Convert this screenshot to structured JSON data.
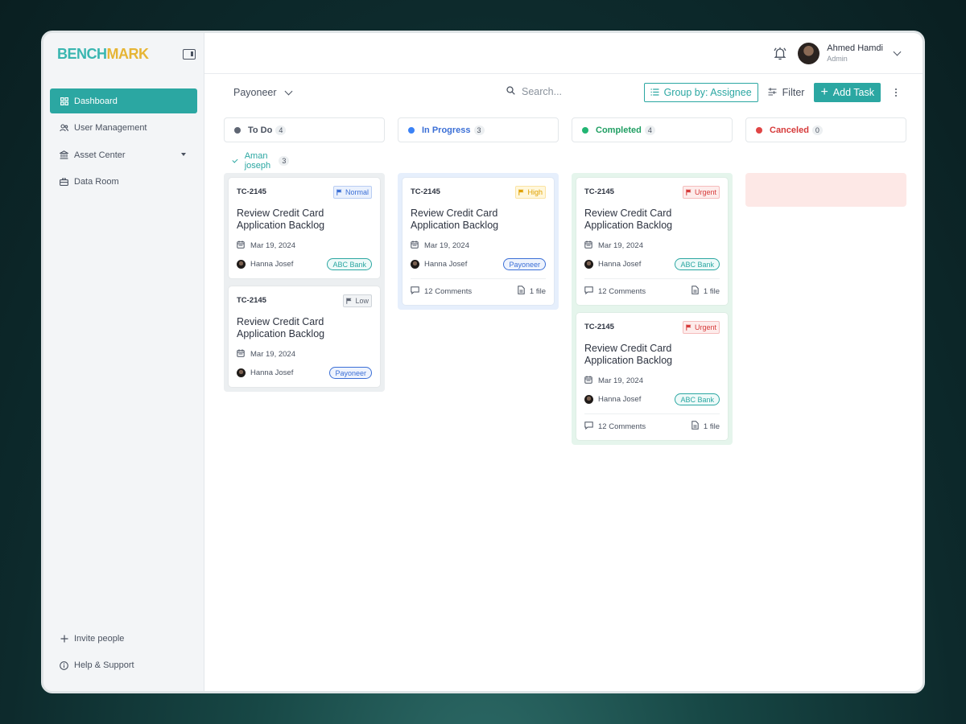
{
  "brand": {
    "logo_part1": "BENCH",
    "logo_part2": "MARK"
  },
  "sidebar": {
    "items": [
      {
        "label": "Dashboard",
        "icon": "grid-icon",
        "active": true
      },
      {
        "label": "User Management",
        "icon": "users-icon"
      },
      {
        "label": "Asset Center",
        "icon": "bank-icon",
        "has_caret": true
      },
      {
        "label": "Data Room",
        "icon": "briefcase-icon"
      }
    ],
    "bottom": [
      {
        "label": "Invite people",
        "icon": "plus-icon"
      },
      {
        "label": "Help & Support",
        "icon": "info-icon"
      }
    ]
  },
  "user": {
    "name": "Ahmed Hamdi",
    "role": "Admin"
  },
  "toolbar": {
    "project": "Payoneer",
    "search_placeholder": "Search...",
    "group_label": "Group by: Assignee",
    "filter_label": "Filter",
    "add_label": "Add Task"
  },
  "columns": [
    {
      "name": "To Do",
      "count": "4",
      "color": "#5f6673"
    },
    {
      "name": "In Progress",
      "count": "3",
      "color": "#3b82f6"
    },
    {
      "name": "Completed",
      "count": "4",
      "color": "#22b573"
    },
    {
      "name": "Canceled",
      "count": "0",
      "color": "#e04545"
    }
  ],
  "group": {
    "name": "Aman joseph",
    "count": "3"
  },
  "cards": {
    "todo": [
      {
        "id": "TC-2145",
        "priority": "Normal",
        "title1": "Review Credit Card",
        "title2": "Application Backlog",
        "date": "Mar 19, 2024",
        "person": "Hanna Josef",
        "org": "ABC Bank"
      },
      {
        "id": "TC-2145",
        "priority": "Low",
        "title1": "Review Credit Card",
        "title2": "Application Backlog",
        "date": "Mar 19, 2024",
        "person": "Hanna Josef",
        "org": "Payoneer"
      }
    ],
    "inprogress": [
      {
        "id": "TC-2145",
        "priority": "High",
        "title1": "Review Credit Card",
        "title2": "Application Backlog",
        "date": "Mar 19, 2024",
        "person": "Hanna Josef",
        "org": "Payoneer",
        "comments": "12 Comments",
        "files": "1 file"
      }
    ],
    "completed": [
      {
        "id": "TC-2145",
        "priority": "Urgent",
        "title1": "Review Credit Card",
        "title2": "Application Backlog",
        "date": "Mar 19, 2024",
        "person": "Hanna Josef",
        "org": "ABC Bank",
        "comments": "12 Comments",
        "files": "1 file"
      },
      {
        "id": "TC-2145",
        "priority": "Urgent",
        "title1": "Review Credit Card",
        "title2": "Application Backlog",
        "date": "Mar 19, 2024",
        "person": "Hanna Josef",
        "org": "ABC Bank",
        "comments": "12 Comments",
        "files": "1 file"
      }
    ]
  },
  "colors": {
    "accent": "#2ba7a2",
    "todo_lane": "#eceff1",
    "progress_lane": "#e6effc",
    "completed_lane": "#e5f5ec",
    "canceled_lane": "#fde8e6"
  }
}
